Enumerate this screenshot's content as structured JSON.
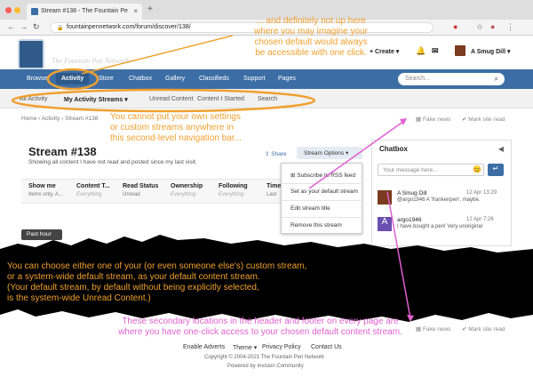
{
  "browser": {
    "tab_title": "Stream #138 - The Fountain Pe",
    "new_tab": "+",
    "url": "fountainpennetwork.com/forum/discover/138/"
  },
  "site": {
    "logo_text": "The Fountain Pen Network",
    "create_label": "Create",
    "user_name": "A Smug Dill"
  },
  "nav": {
    "items": [
      {
        "label": "Browse"
      },
      {
        "label": "Activity"
      },
      {
        "label": "Store"
      },
      {
        "label": "Chatbox"
      },
      {
        "label": "Gallery"
      },
      {
        "label": "Classifieds"
      },
      {
        "label": "Support"
      },
      {
        "label": "Pages"
      }
    ],
    "search_placeholder": "Search..."
  },
  "subnav": {
    "items": [
      {
        "label": "All Activity"
      },
      {
        "label": "My Activity Streams"
      },
      {
        "label": "Unread Content"
      },
      {
        "label": "Content I Started"
      },
      {
        "label": "Search"
      }
    ]
  },
  "breadcrumb": "Home › Activity › Stream #138",
  "top_actions": {
    "fake_news": "Fake news",
    "mark_read": "Mark site read"
  },
  "stream": {
    "title": "Stream #138",
    "description": "Showing all content I have not read and posted since my last visit.",
    "share": "Share",
    "options": "Stream Options",
    "filters": [
      {
        "header": "Show me",
        "value": "Items only, A..."
      },
      {
        "header": "Content T...",
        "value": "Everything"
      },
      {
        "header": "Read Status",
        "value": "Unread"
      },
      {
        "header": "Ownership",
        "value": "Everything"
      },
      {
        "header": "Following",
        "value": "Everything"
      },
      {
        "header": "Time",
        "value": "Last"
      }
    ]
  },
  "dropdown": {
    "items": [
      {
        "label": "Subscribe to RSS feed"
      },
      {
        "label": "Set as your default stream"
      },
      {
        "label": "Edit stream title"
      },
      {
        "label": "Remove this stream"
      }
    ]
  },
  "past_hour": "Past hour",
  "chatbox": {
    "title": "Chatbox",
    "placeholder": "Your message here...",
    "messages": [
      {
        "name": "A Smug Dill",
        "time": "12 Apr 13:29",
        "text": "@argo1946 A 'frankenpen', maybe."
      },
      {
        "name": "argo1946",
        "time": "12 Apr 7:26",
        "text": "I have bought a pen! Very unoriginal"
      }
    ]
  },
  "annotations": {
    "orange_top": "... and definitely not up here\nwhere you may imagine your\nchosen default would always\nbe accessible with one click.",
    "orange_mid": "You cannot put your own settings\nor custom streams anywhere in\nthis second-level navigation bar...",
    "orange_band": "You can choose either one of your (or even someone else's) custom stream,\nor a system-wide default stream, as your default content stream.\n(Your default stream, by default without being explicitly selected,\nis the system-wide Unread Content.)",
    "pink_bottom": "These secondary locations in the header and footer on every page are\nwhere you have one-click access to your chosen default content stream."
  },
  "footer": {
    "links": [
      {
        "label": "Enable Adverts"
      },
      {
        "label": "Theme ▾"
      },
      {
        "label": "Privacy Policy"
      },
      {
        "label": "Contact Us"
      }
    ],
    "copyright": "Copyright © 2004-2021 The Fountain Pen Network",
    "powered": "Powered by Invision Community"
  },
  "colors": {
    "nav_blue": "#3c6ea5",
    "orange": "#f0a030",
    "pink": "#e060d0"
  }
}
